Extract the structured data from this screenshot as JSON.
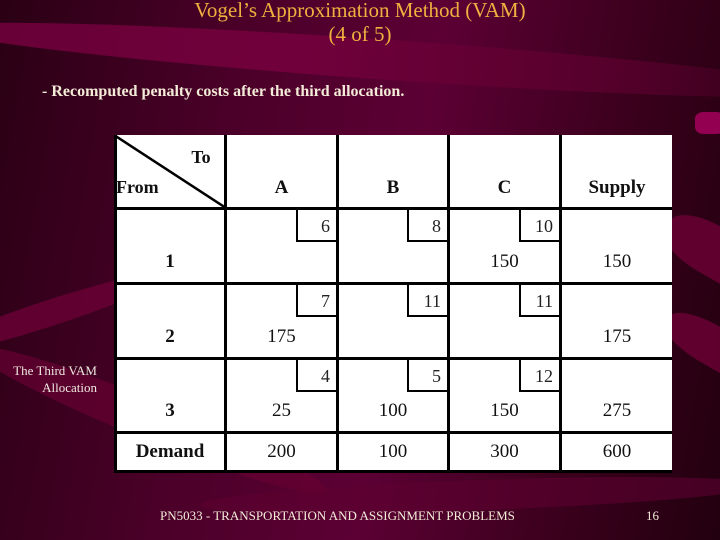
{
  "slide": {
    "title_line1": "Vogel’s Approximation Method (VAM)",
    "title_line2": "(4 of 5)",
    "bullet": "- Recomputed penalty costs after the third allocation.",
    "side_caption_line1": "The Third VAM",
    "side_caption_line2": "Allocation",
    "footer": "PN5033 - TRANSPORTATION AND ASSIGNMENT PROBLEMS",
    "page_number": "16"
  },
  "colors": {
    "title": "#f0b040",
    "background": "#4a0028",
    "accent": "#6a0038"
  },
  "table": {
    "corner_to": "To",
    "corner_from": "From",
    "columns": [
      "A",
      "B",
      "C",
      "Supply"
    ],
    "rows": [
      {
        "label": "1",
        "costs": [
          "6",
          "8",
          "10"
        ],
        "allocations": [
          "",
          "",
          "150"
        ],
        "supply": "150"
      },
      {
        "label": "2",
        "costs": [
          "7",
          "11",
          "11"
        ],
        "allocations": [
          "175",
          "",
          ""
        ],
        "supply": "175"
      },
      {
        "label": "3",
        "costs": [
          "4",
          "5",
          "12"
        ],
        "allocations": [
          "25",
          "100",
          "150"
        ],
        "supply": "275"
      }
    ],
    "demand": {
      "label": "Demand",
      "values": [
        "200",
        "100",
        "300"
      ],
      "total": "600"
    }
  }
}
